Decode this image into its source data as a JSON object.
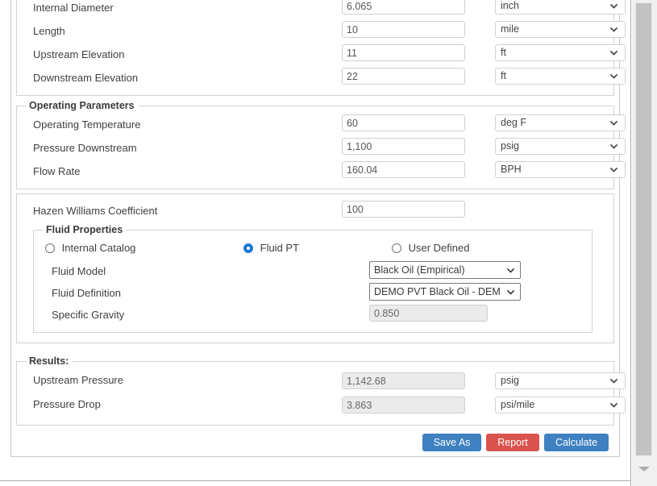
{
  "pipe_group": {
    "rows": [
      {
        "label": "Internal Diameter",
        "value": "6.065",
        "unit": "inch"
      },
      {
        "label": "Length",
        "value": "10",
        "unit": "mile"
      },
      {
        "label": "Upstream Elevation",
        "value": "11",
        "unit": "ft"
      },
      {
        "label": "Downstream Elevation",
        "value": "22",
        "unit": "ft"
      }
    ]
  },
  "operating_parameters": {
    "legend": "Operating Parameters",
    "rows": [
      {
        "label": "Operating Temperature",
        "value": "60",
        "unit": "deg F"
      },
      {
        "label": "Pressure Downstream",
        "value": "1,100",
        "unit": "psig"
      },
      {
        "label": "Flow Rate",
        "value": "160.04",
        "unit": "BPH"
      }
    ]
  },
  "hazen": {
    "label": "Hazen Williams Coefficient",
    "value": "100"
  },
  "fluid_properties": {
    "legend": "Fluid Properties",
    "radios": [
      {
        "label": "Internal Catalog",
        "checked": false
      },
      {
        "label": "Fluid PT",
        "checked": true
      },
      {
        "label": "User Defined",
        "checked": false
      }
    ],
    "fluid_model": {
      "label": "Fluid Model",
      "value": "Black Oil (Empirical)"
    },
    "fluid_definition": {
      "label": "Fluid Definition",
      "value": "DEMO PVT Black Oil - DEM"
    },
    "specific_gravity": {
      "label": "Specific Gravity",
      "value": "0.850"
    }
  },
  "results": {
    "legend": "Results:",
    "rows": [
      {
        "label": "Upstream Pressure",
        "value": "1,142.68",
        "unit": "psig"
      },
      {
        "label": "Pressure Drop",
        "value": "3.863",
        "unit": "psi/mile"
      }
    ]
  },
  "buttons": {
    "save_as": "Save As",
    "report": "Report",
    "calculate": "Calculate"
  },
  "colors": {
    "primary": "#3e80c0",
    "danger": "#d9534f",
    "radio_accent": "#1878d4",
    "readonly_bg": "#ebebeb"
  },
  "icons": {
    "chevron_down": "chevron-down-icon",
    "scroll_down": "scroll-down-arrow-icon"
  }
}
